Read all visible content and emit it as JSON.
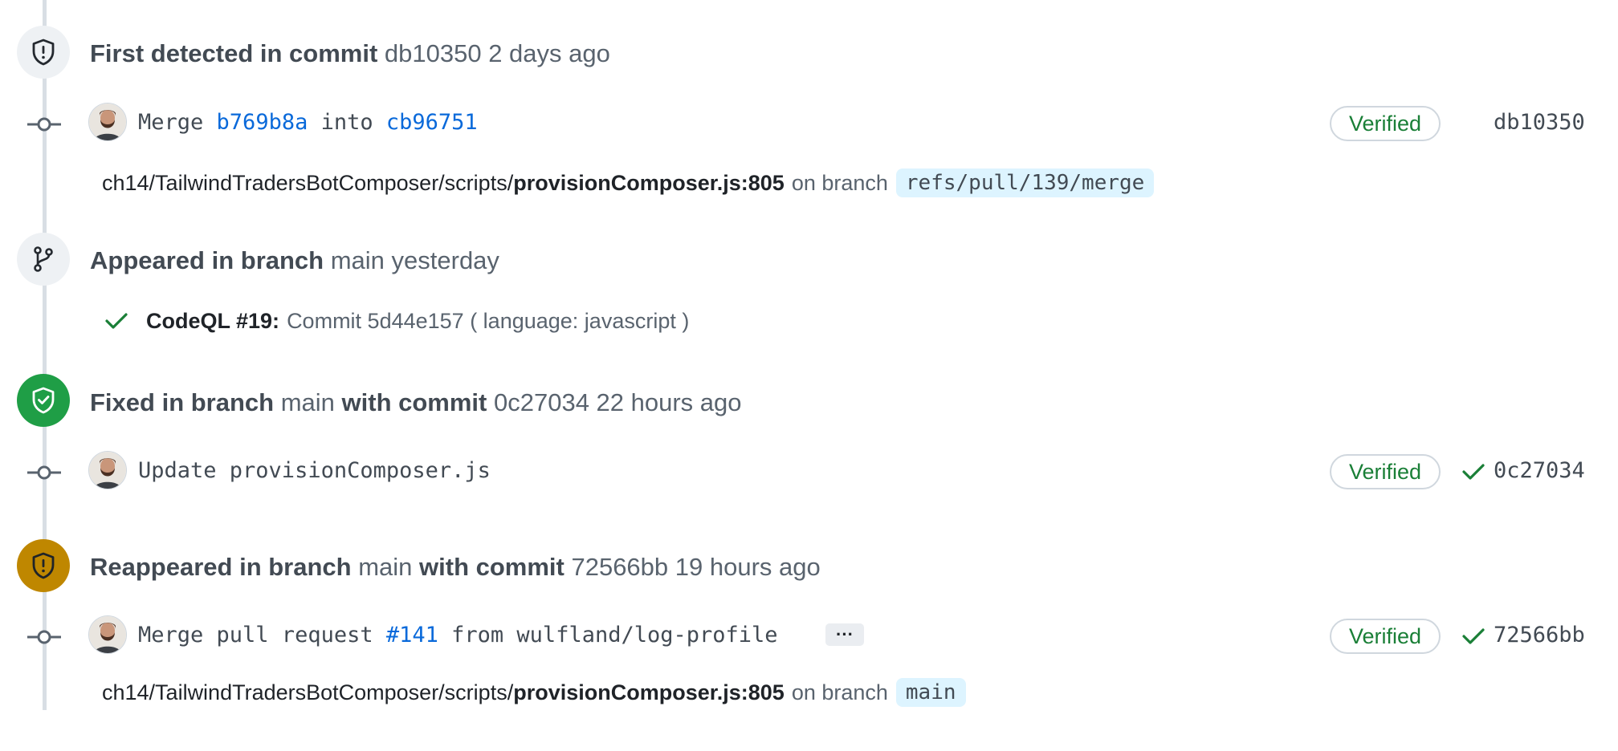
{
  "colors": {
    "link": "#0969da",
    "verified": "#1a7f37",
    "fixed_badge": "#1f9e46",
    "reappeared_badge": "#bf8700",
    "branch_label_bg": "#ddf4ff"
  },
  "events": [
    {
      "icon": "shield-alert-icon",
      "title_strong": "First detected in commit",
      "title_rest": " db10350 2 days ago",
      "commit": {
        "parts": [
          "Merge ",
          "b769b8a",
          " into ",
          "cb96751"
        ],
        "verified": "Verified",
        "sha": "db10350"
      },
      "location": {
        "path": "ch14/TailwindTradersBotComposer/scripts/",
        "file": "provisionComposer.js:805",
        "on_branch": "on branch",
        "branch": "refs/pull/139/merge"
      }
    },
    {
      "icon": "git-branch-icon",
      "title_strong": "Appeared in branch",
      "title_rest": " main yesterday",
      "analysis": {
        "tool": "CodeQL #19:",
        "text": "Commit 5d44e157 ( language: javascript )"
      }
    },
    {
      "icon": "shield-check-icon",
      "title_parts": [
        "Fixed in branch",
        " main ",
        "with commit",
        " 0c27034 22 hours ago"
      ],
      "commit": {
        "message": "Update provisionComposer.js",
        "verified": "Verified",
        "sha": "0c27034"
      }
    },
    {
      "icon": "shield-alert-icon",
      "title_parts": [
        "Reappeared in branch",
        " main ",
        "with commit",
        " 72566bb 19 hours ago"
      ],
      "commit": {
        "parts": [
          "Merge pull request ",
          "#141",
          " from wulfland/log-profile"
        ],
        "more": "···",
        "verified": "Verified",
        "sha": "72566bb"
      },
      "location": {
        "path": "ch14/TailwindTradersBotComposer/scripts/",
        "file": "provisionComposer.js:805",
        "on_branch": "on branch",
        "branch": "main"
      }
    }
  ]
}
